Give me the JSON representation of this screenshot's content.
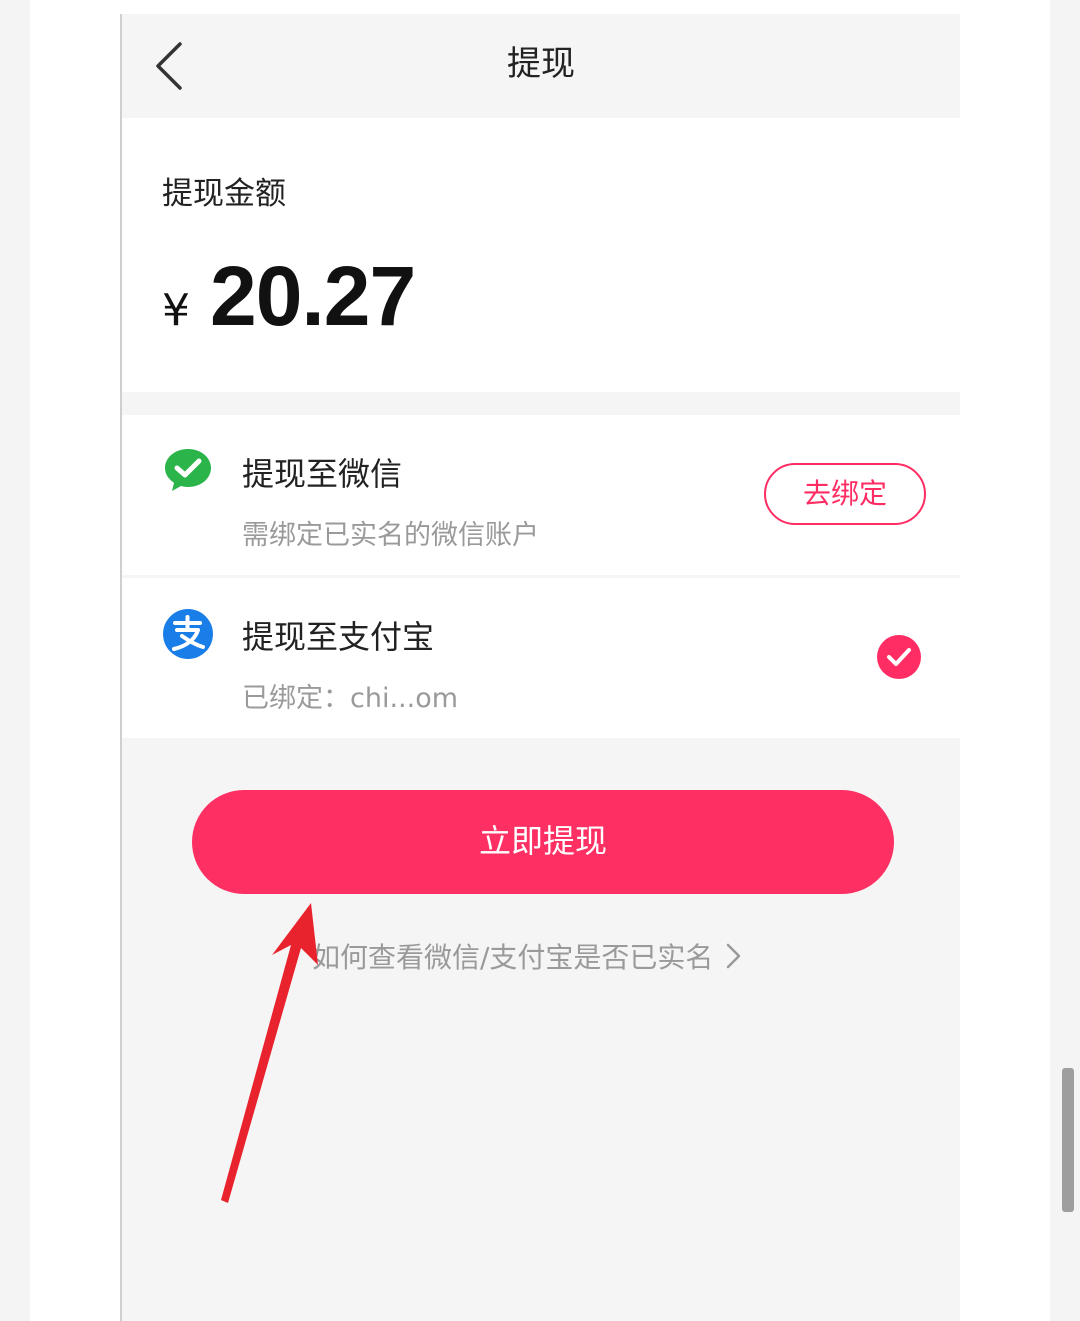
{
  "nav": {
    "title": "提现",
    "back_icon": "chevron-left-icon"
  },
  "amount": {
    "label": "提现金额",
    "currency": "¥",
    "value": "20.27"
  },
  "methods": [
    {
      "id": "wechat",
      "icon": "wechat-icon",
      "title": "提现至微信",
      "subtitle": "需绑定已实名的微信账户",
      "action_label": "去绑定",
      "selected": false
    },
    {
      "id": "alipay",
      "icon": "alipay-icon",
      "title": "提现至支付宝",
      "subtitle": "已绑定：chi...om",
      "selected": true
    }
  ],
  "submit_label": "立即提现",
  "help_link": "如何查看微信/支付宝是否已实名",
  "colors": {
    "accent": "#fe2f63",
    "wechat": "#2ab44a",
    "alipay": "#1a7ee8",
    "annotation_arrow": "#e8232e"
  }
}
